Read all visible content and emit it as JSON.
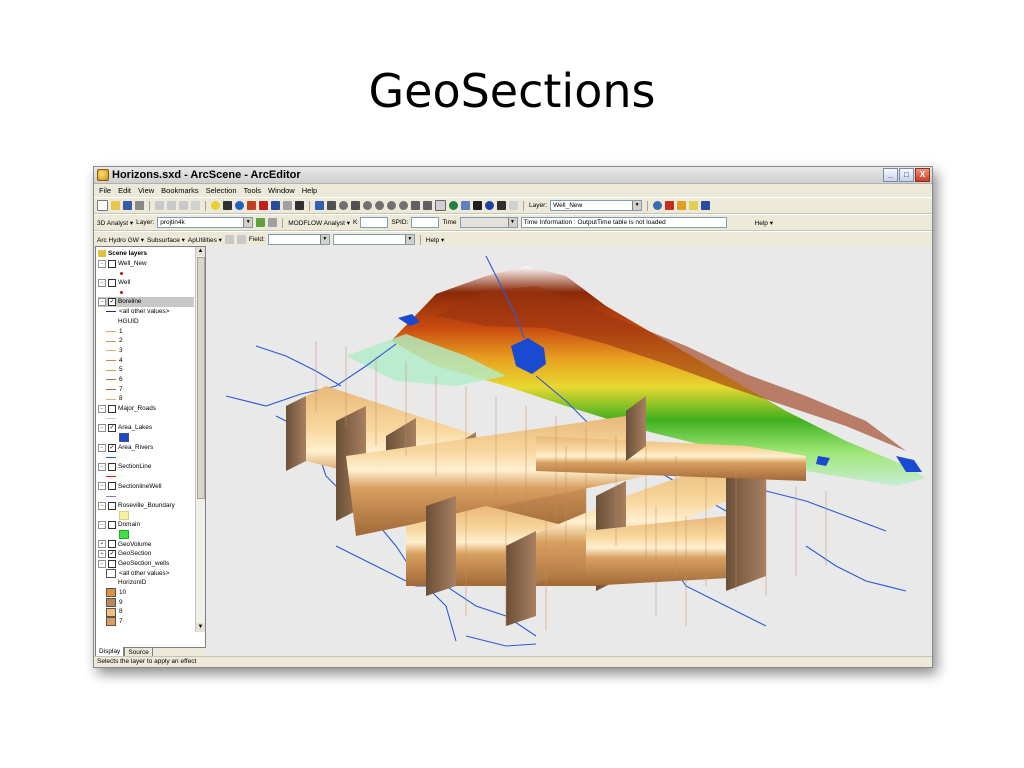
{
  "slide": {
    "title": "GeoSections"
  },
  "window": {
    "title": "Horizons.sxd - ArcScene - ArcEditor",
    "buttons": {
      "minimize": "_",
      "maximize": "□",
      "close": "X"
    }
  },
  "menu": [
    "File",
    "Edit",
    "View",
    "Bookmarks",
    "Selection",
    "Tools",
    "Window",
    "Help"
  ],
  "toolbar1": {
    "layer_label": "Layer:",
    "layer_value": "Well_New"
  },
  "toolbar2": {
    "analyst": "3D Analyst ▾",
    "layer_label": "Layer:",
    "layer_value": "projtin4k",
    "modflow": "MODFLOW Analyst ▾",
    "k_label": "K",
    "spid_label": "SPID:",
    "time_label": "Time",
    "time_info": "Time Information : OutputTime table is not loaded",
    "help": "Help ▾"
  },
  "toolbar3": {
    "archydro": "Arc Hydro GW ▾",
    "subsurface": "Subsurface ▾",
    "aputilities": "ApUtilities ▾",
    "field_label": "Field:",
    "help": "Help ▾"
  },
  "toc": {
    "close": "×",
    "root": "Scene layers",
    "items": [
      {
        "label": "Well_New"
      },
      {
        "label": "Well"
      },
      {
        "label": "Boreline"
      },
      {
        "label": "<all other values>"
      },
      {
        "label": "HGUID"
      },
      {
        "label": "1"
      },
      {
        "label": "2"
      },
      {
        "label": "3"
      },
      {
        "label": "4"
      },
      {
        "label": "5"
      },
      {
        "label": "6"
      },
      {
        "label": "7"
      },
      {
        "label": "8"
      },
      {
        "label": "Major_Roads"
      },
      {
        "label": "Area_Lakes"
      },
      {
        "label": "Area_Rivers"
      },
      {
        "label": "SectionLine"
      },
      {
        "label": "SectionlineWell"
      },
      {
        "label": "Roseville_Boundary"
      },
      {
        "label": "Domain"
      },
      {
        "label": "GeoVolume"
      },
      {
        "label": "GeoSection"
      },
      {
        "label": "GeoSection_wells"
      },
      {
        "label": "<all other values>"
      },
      {
        "label": "HorizonID"
      },
      {
        "label": "10"
      },
      {
        "label": "9"
      },
      {
        "label": "8"
      },
      {
        "label": "7"
      }
    ],
    "tabs": [
      "Display",
      "Source"
    ]
  },
  "status": "Selects the layer to apply an effect",
  "colors": {
    "terrain_high": "#8a2a08",
    "terrain_mid": "#e8c020",
    "terrain_low": "#22a018",
    "water": "#1a4ad0",
    "river": "#2a5ad8",
    "section_light": "#f0c890",
    "section_dark": "#6a5038"
  }
}
